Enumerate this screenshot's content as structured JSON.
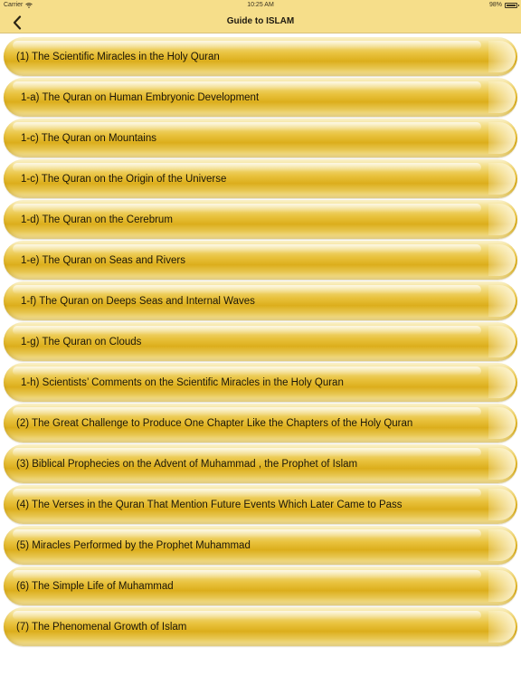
{
  "status": {
    "carrier": "Carrier",
    "time": "10:25 AM",
    "battery": "98%",
    "battery_level": 0.98
  },
  "nav": {
    "title": "Guide to ISLAM"
  },
  "items": [
    {
      "label": "(1) The Scientific Miracles in the Holy Quran",
      "indent": false
    },
    {
      "label": "1-a) The Quran on Human Embryonic Development",
      "indent": true
    },
    {
      "label": "1-c) The Quran on Mountains",
      "indent": true
    },
    {
      "label": "1-c) The Quran on the Origin of the Universe",
      "indent": true
    },
    {
      "label": "1-d) The Quran on the Cerebrum",
      "indent": true
    },
    {
      "label": "1-e) The Quran on Seas and Rivers",
      "indent": true
    },
    {
      "label": "1-f) The Quran on Deeps Seas and Internal Waves",
      "indent": true
    },
    {
      "label": "1-g) The Quran on Clouds",
      "indent": true
    },
    {
      "label": "1-h) Scientists’ Comments on the Scientific Miracles in the Holy Quran",
      "indent": true
    },
    {
      "label": "(2) The Great Challenge to Produce One Chapter Like the Chapters of the Holy Quran",
      "indent": false
    },
    {
      "label": "(3) Biblical Prophecies on the Advent of Muhammad , the Prophet of Islam",
      "indent": false
    },
    {
      "label": "(4) The Verses in the Quran That Mention Future Events Which Later Came to Pass",
      "indent": false
    },
    {
      "label": "(5) Miracles Performed by the Prophet Muhammad",
      "indent": false
    },
    {
      "label": "(6) The Simple Life of Muhammad",
      "indent": false
    },
    {
      "label": "(7) The Phenomenal Growth of Islam",
      "indent": false
    }
  ]
}
